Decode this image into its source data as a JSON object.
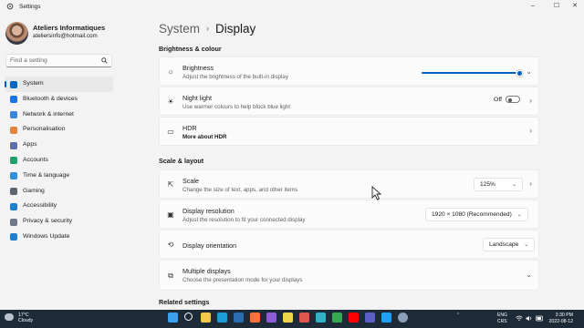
{
  "window": {
    "title": "Settings",
    "controls": {
      "minimize": "–",
      "maximize": "☐",
      "close": "✕"
    }
  },
  "profile": {
    "name": "Ateliers Informatiques",
    "email": "ateliersinfo@hotmail.com"
  },
  "search": {
    "placeholder": "Find a setting"
  },
  "nav": {
    "items": [
      {
        "label": "System",
        "color": "#0067c0",
        "active": true
      },
      {
        "label": "Bluetooth & devices",
        "color": "#1a73e8"
      },
      {
        "label": "Network & internet",
        "color": "#3a86d8"
      },
      {
        "label": "Personalisation",
        "color": "#e3833c"
      },
      {
        "label": "Apps",
        "color": "#5b6fa8"
      },
      {
        "label": "Accounts",
        "color": "#22a06b"
      },
      {
        "label": "Time & language",
        "color": "#2f8fdc"
      },
      {
        "label": "Gaming",
        "color": "#5b6670"
      },
      {
        "label": "Accessibility",
        "color": "#1f7fd1"
      },
      {
        "label": "Privacy & security",
        "color": "#6e7a86"
      },
      {
        "label": "Windows Update",
        "color": "#1f7fd1"
      }
    ]
  },
  "breadcrumb": {
    "root": "System",
    "separator": "›",
    "current": "Display"
  },
  "sections": {
    "brightness": "Brightness & colour",
    "scale": "Scale & layout",
    "related": "Related settings"
  },
  "cards": {
    "brightness": {
      "title": "Brightness",
      "subtitle": "Adjust the brightness of the built-in display",
      "value": 1.0
    },
    "night_light": {
      "title": "Night light",
      "subtitle": "Use warmer colours to help block blue light",
      "state": "Off"
    },
    "hdr": {
      "title": "HDR",
      "subtitle": "More about HDR"
    },
    "scale": {
      "title": "Scale",
      "subtitle": "Change the size of text, apps, and other items",
      "value": "125%"
    },
    "resolution": {
      "title": "Display resolution",
      "subtitle": "Adjust the resolution to fit your connected display",
      "value": "1920 × 1080 (Recommended)"
    },
    "orientation": {
      "title": "Display orientation",
      "value": "Landscape"
    },
    "multiple": {
      "title": "Multiple displays",
      "subtitle": "Choose the presentation mode for your displays"
    }
  },
  "taskbar": {
    "weather": {
      "temp": "17°C",
      "desc": "Cloudy"
    },
    "lang": {
      "top": "ENG",
      "bottom": "CRS"
    },
    "clock": {
      "time": "3:30 PM",
      "date": "2022-08-12"
    },
    "apps": [
      {
        "name": "windows",
        "color": "#3aa0f0"
      },
      {
        "name": "search",
        "color": "#ffffff"
      },
      {
        "name": "files",
        "color": "#f2c84b"
      },
      {
        "name": "edge",
        "color": "#1d9bd7"
      },
      {
        "name": "store",
        "color": "#2b6cb0"
      },
      {
        "name": "firefox",
        "color": "#ff7139"
      },
      {
        "name": "photos",
        "color": "#8e5cd9"
      },
      {
        "name": "notes",
        "color": "#f0d44a"
      },
      {
        "name": "pdf",
        "color": "#e2574c"
      },
      {
        "name": "browser",
        "color": "#2fb2c4"
      },
      {
        "name": "chrome",
        "color": "#34a853"
      },
      {
        "name": "youtube",
        "color": "#ff0000"
      },
      {
        "name": "teams",
        "color": "#5b5fc7"
      },
      {
        "name": "twitter",
        "color": "#1da1f2"
      },
      {
        "name": "settings",
        "color": "#8aa0b8"
      }
    ]
  }
}
